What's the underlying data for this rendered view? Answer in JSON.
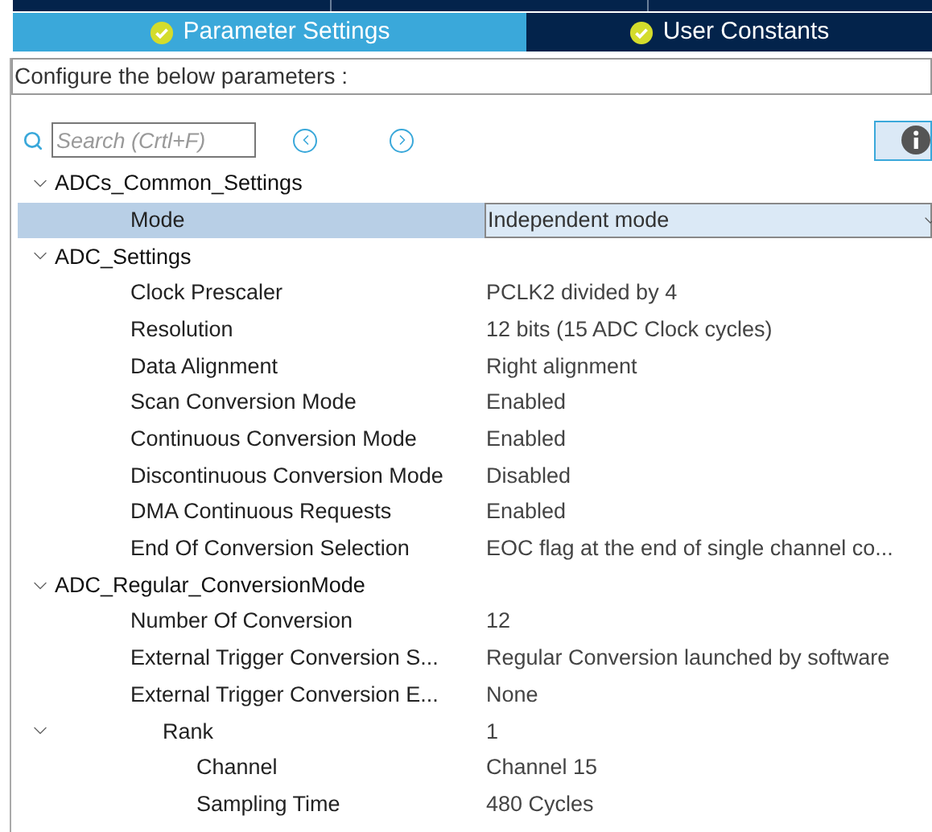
{
  "tabs": [
    {
      "label": "Parameter Settings",
      "selected": true,
      "checked": true
    },
    {
      "label": "User Constants",
      "selected": false,
      "checked": true
    }
  ],
  "configure_label": "Configure the below parameters :",
  "search": {
    "placeholder": "Search (Crtl+F)"
  },
  "tree": [
    {
      "label": "ADCs_Common_Settings",
      "expanded": true,
      "children": [
        {
          "label": "Mode",
          "value": "Independent mode",
          "kind": "dropdown",
          "selected": true
        }
      ]
    },
    {
      "label": "ADC_Settings",
      "expanded": true,
      "children": [
        {
          "label": "Clock Prescaler",
          "value": "PCLK2 divided by 4",
          "kind": "text",
          "selected": false
        },
        {
          "label": "Resolution",
          "value": "12 bits (15 ADC Clock cycles)",
          "kind": "text",
          "selected": false
        },
        {
          "label": "Data Alignment",
          "value": "Right alignment",
          "kind": "text",
          "selected": false
        },
        {
          "label": "Scan Conversion Mode",
          "value": "Enabled",
          "kind": "text",
          "selected": false
        },
        {
          "label": "Continuous Conversion Mode",
          "value": "Enabled",
          "kind": "text",
          "selected": false
        },
        {
          "label": "Discontinuous Conversion Mode",
          "value": "Disabled",
          "kind": "text",
          "selected": false
        },
        {
          "label": "DMA Continuous Requests",
          "value": "Enabled",
          "kind": "text",
          "selected": false
        },
        {
          "label": "End Of Conversion Selection",
          "value": "EOC flag at the end of single channel co...",
          "kind": "text",
          "selected": false
        }
      ]
    },
    {
      "label": "ADC_Regular_ConversionMode",
      "expanded": true,
      "children": [
        {
          "label": "Number Of Conversion",
          "value": "12",
          "kind": "text",
          "selected": false
        },
        {
          "label": "External Trigger Conversion S...",
          "value": "Regular Conversion launched by software",
          "kind": "text",
          "selected": false
        },
        {
          "label": "External Trigger Conversion E...",
          "value": "None",
          "kind": "text",
          "selected": false
        },
        {
          "label": "Rank",
          "value": "1",
          "kind": "text",
          "selected": false,
          "expanded": true,
          "children": [
            {
              "label": "Channel",
              "value": "Channel 15",
              "kind": "text",
              "selected": false
            },
            {
              "label": "Sampling Time",
              "value": "480 Cycles",
              "kind": "text",
              "selected": false
            }
          ]
        }
      ]
    }
  ]
}
